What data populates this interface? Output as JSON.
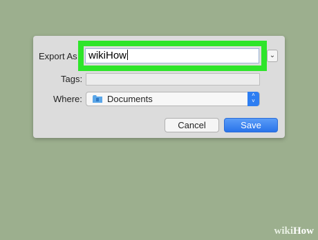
{
  "dialog": {
    "export_as_label": "Export As",
    "name_value": "wikiHow",
    "tags_label": "Tags:",
    "where_label": "Where:",
    "where_value": "Documents",
    "cancel_label": "Cancel",
    "save_label": "Save"
  },
  "icons": {
    "folder": "folder-icon",
    "expand": "chevron-down-icon",
    "stepper": "up-down-chevron-icon"
  },
  "colors": {
    "highlight": "#2ee52a",
    "accent": "#2d7ef2",
    "background": "#9caf8e"
  },
  "watermark": {
    "part1": "wiki",
    "part2": "How"
  }
}
